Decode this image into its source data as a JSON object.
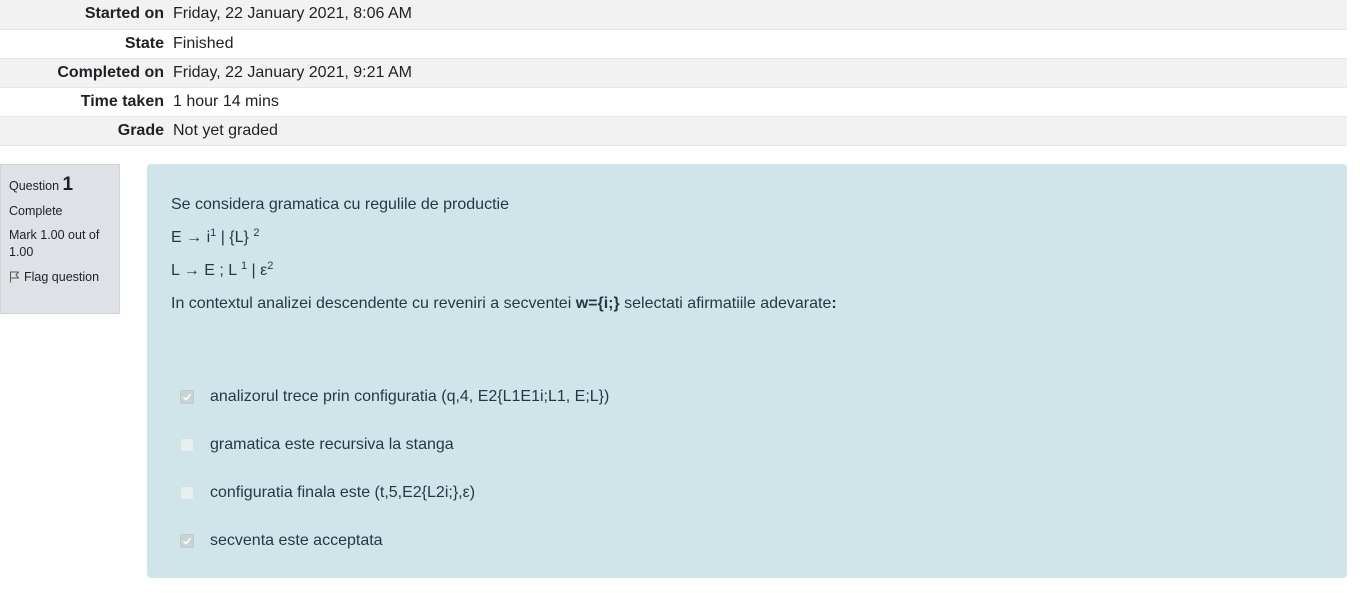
{
  "summary": {
    "rows": [
      {
        "label": "Started on",
        "value": "Friday, 22 January 2021, 8:06 AM"
      },
      {
        "label": "State",
        "value": "Finished"
      },
      {
        "label": "Completed on",
        "value": "Friday, 22 January 2021, 9:21 AM"
      },
      {
        "label": "Time taken",
        "value": "1 hour 14 mins"
      },
      {
        "label": "Grade",
        "value": "Not yet graded"
      }
    ]
  },
  "question_info": {
    "question_word": "Question",
    "number": "1",
    "state": "Complete",
    "grade": "Mark 1.00 out of 1.00",
    "flag_label": "Flag question"
  },
  "question": {
    "intro": "Se considera gramatica cu regulile de productie",
    "rule1": {
      "a": "E → i",
      "sup1": "1",
      "b": " | {L} ",
      "sup2": "2"
    },
    "rule2": {
      "a": "L → E ; L ",
      "sup1": "1",
      "b": " | ε",
      "sup2": "2"
    },
    "prompt": {
      "before": "In contextul analizei descendente cu reveniri a secventei ",
      "bold": "w={i;}",
      "after": " selectati afirmatiile adevarate",
      "end": ":"
    },
    "answers": [
      {
        "label": "analizorul trece prin configuratia (q,4, E2{L1E1i;L1, E;L})",
        "checked": true
      },
      {
        "label": "gramatica este recursiva la stanga",
        "checked": false
      },
      {
        "label": "configuratia finala este (t,5,E2{L2i;},ε)",
        "checked": false
      },
      {
        "label": "secventa este acceptata",
        "checked": true
      }
    ]
  },
  "colors": {
    "content_bg": "#cfe5ea",
    "info_bg": "#dee2e6",
    "summary_stripe": "#f2f2f2"
  },
  "icons": {
    "flag": "flag-outline-icon",
    "checkbox": "checkbox-icon"
  }
}
